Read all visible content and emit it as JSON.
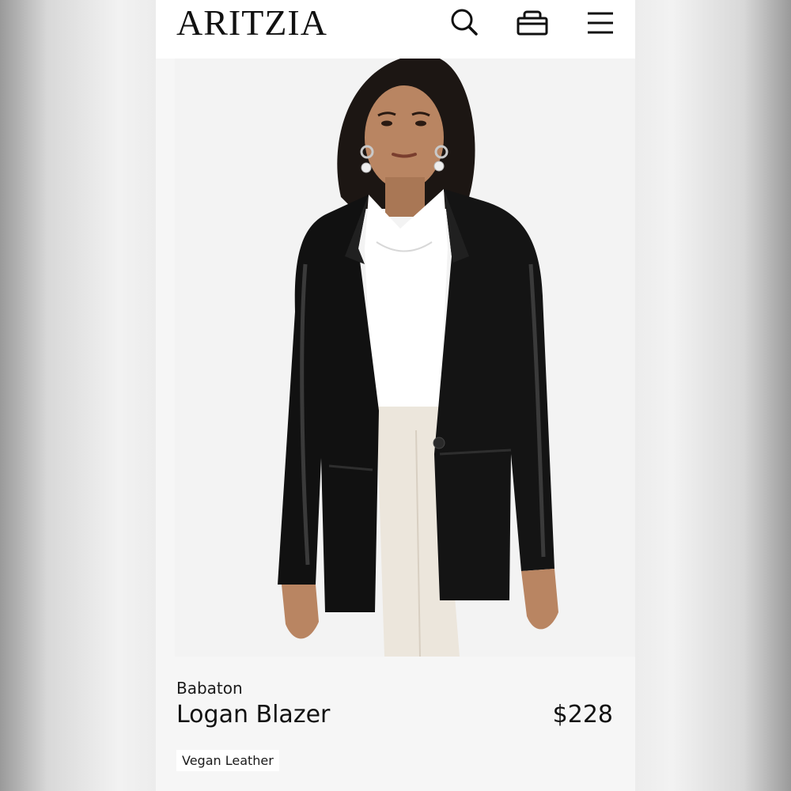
{
  "header": {
    "logo": "ARITZIA",
    "icons": [
      "search-icon",
      "bag-icon",
      "menu-icon"
    ]
  },
  "product": {
    "image_description_icon": "product-photo",
    "brand": "Babaton",
    "name": "Logan Blazer",
    "price": "$228",
    "material_tag": "Vegan Leather"
  },
  "colors": {
    "background": "#f6f6f6",
    "header": "#ffffff",
    "text": "#111111",
    "jacket": "#111111",
    "top": "#ffffff",
    "trousers": "#ece6dc"
  }
}
